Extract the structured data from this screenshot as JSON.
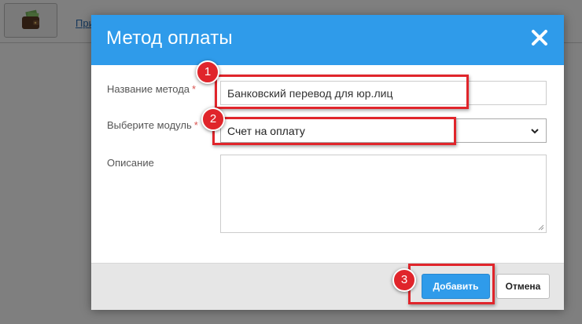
{
  "background": {
    "link_text": "При"
  },
  "modal": {
    "title": "Метод оплаты",
    "fields": {
      "method_name": {
        "label": "Название метода",
        "required_mark": "*",
        "value": "Банковский перевод для юр.лиц"
      },
      "module": {
        "label": "Выберите модуль",
        "required_mark": "*",
        "selected": "Счет на оплату"
      },
      "description": {
        "label": "Описание",
        "value": ""
      }
    },
    "buttons": {
      "add_label": "Добавить",
      "cancel_label": "Отмена"
    }
  },
  "annotations": {
    "markers": [
      "1",
      "2",
      "3"
    ],
    "color": "#e0252b"
  },
  "colors": {
    "header": "#2f9bea",
    "primary_button": "#2f9bea",
    "required": "#d9534f"
  },
  "icons": {
    "wallet": "wallet-icon",
    "close": "close-icon",
    "select_arrow": "chevron-down-icon"
  }
}
